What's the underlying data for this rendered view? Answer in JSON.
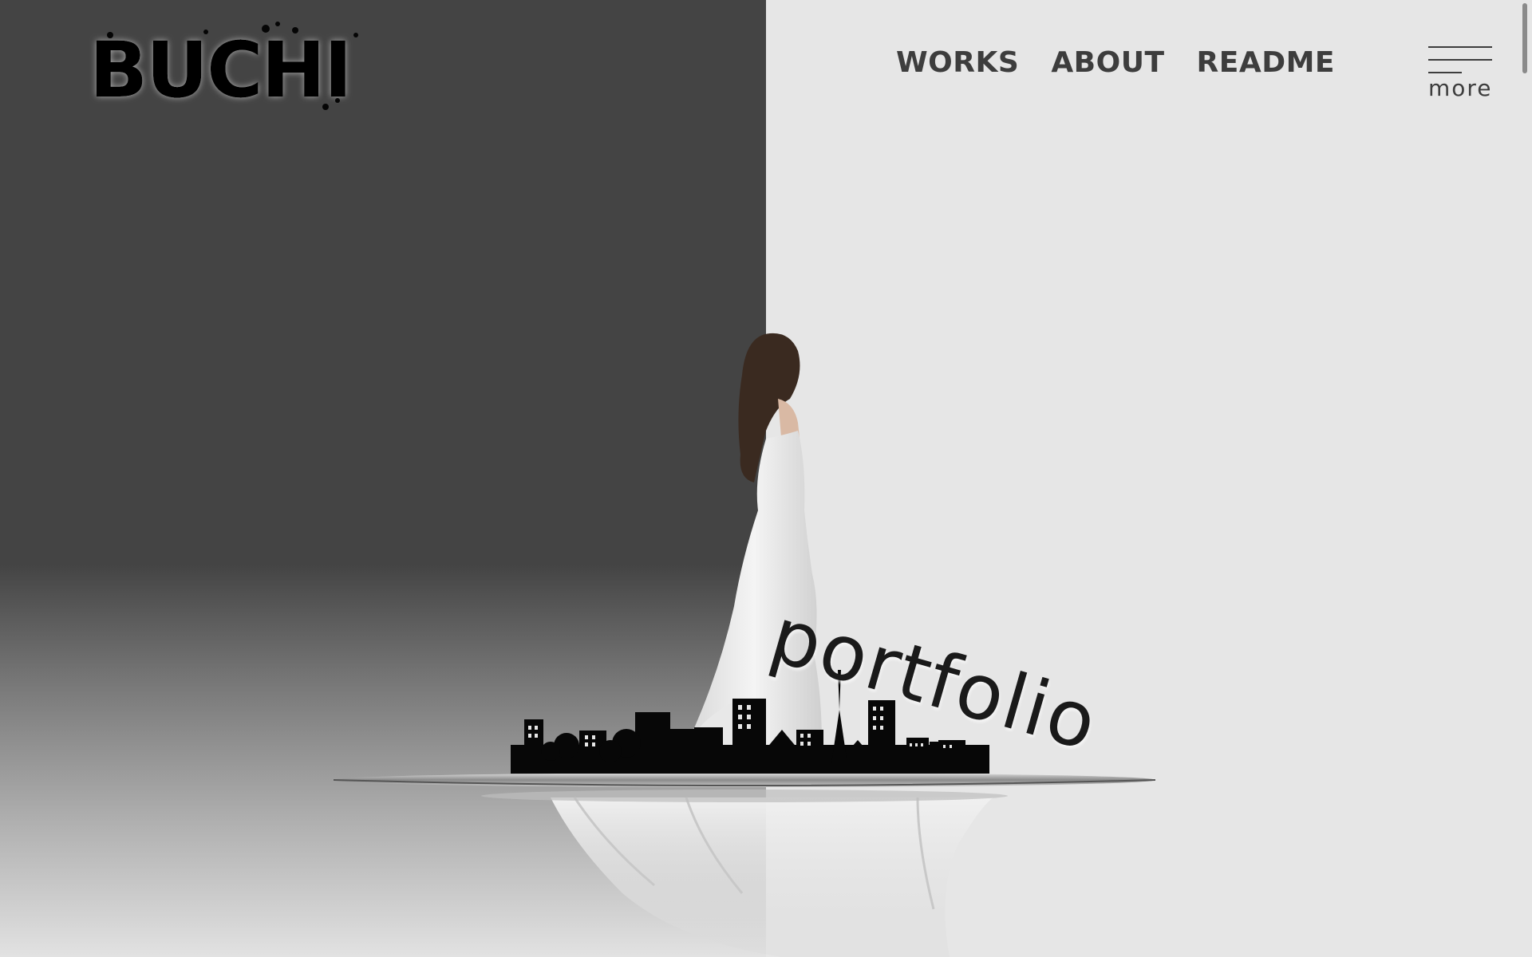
{
  "brand": {
    "logo_text": "BUCHI"
  },
  "nav": {
    "items": [
      {
        "label": "WORKS"
      },
      {
        "label": "ABOUT"
      },
      {
        "label": "README"
      }
    ]
  },
  "menu": {
    "label": "more"
  },
  "hero": {
    "title": "portfolio"
  },
  "colors": {
    "dark_panel": "#444444",
    "light_panel": "#e6e6e6",
    "text": "#3d3d3d"
  }
}
